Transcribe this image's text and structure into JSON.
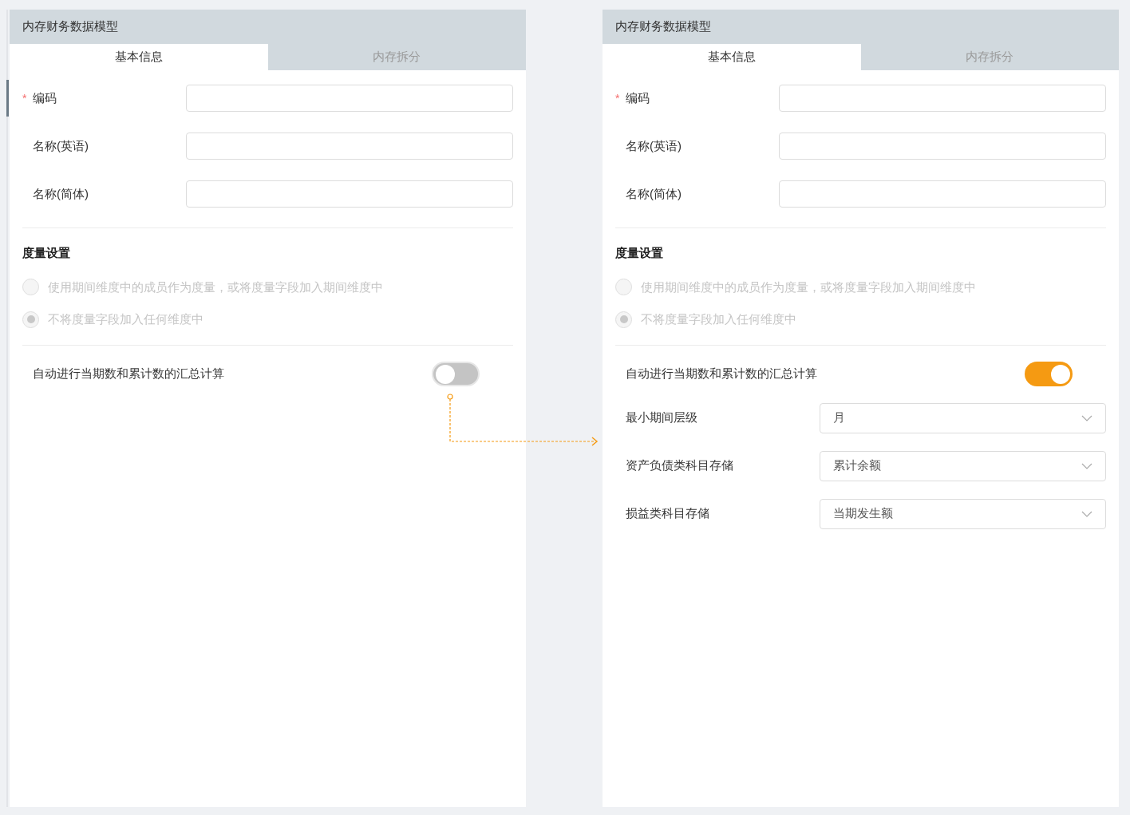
{
  "panels": [
    {
      "title": "内存财务数据模型",
      "tabs": [
        {
          "label": "基本信息",
          "selected": true
        },
        {
          "label": "内存拆分",
          "selected": false
        }
      ],
      "fields": [
        {
          "required_mark": "*",
          "label": "编码"
        },
        {
          "label": "名称(英语)"
        },
        {
          "label": "名称(简体)"
        }
      ],
      "section_title": "度量设置",
      "radios": [
        {
          "label": "使用期间维度中的成员作为度量，或将度量字段加入期间维度中",
          "selected": false,
          "disabled": true
        },
        {
          "label": "不将度量字段加入任何维度中",
          "selected": true,
          "disabled": true
        }
      ],
      "toggle": {
        "label": "自动进行当期数和累计数的汇总计算",
        "on": false
      }
    },
    {
      "title": "内存财务数据模型",
      "tabs": [
        {
          "label": "基本信息",
          "selected": true
        },
        {
          "label": "内存拆分",
          "selected": false
        }
      ],
      "fields": [
        {
          "required_mark": "*",
          "label": "编码"
        },
        {
          "label": "名称(英语)"
        },
        {
          "label": "名称(简体)"
        }
      ],
      "section_title": "度量设置",
      "radios": [
        {
          "label": "使用期间维度中的成员作为度量，或将度量字段加入期间维度中",
          "selected": false,
          "disabled": true
        },
        {
          "label": "不将度量字段加入任何维度中",
          "selected": true,
          "disabled": true
        }
      ],
      "toggle": {
        "label": "自动进行当期数和累计数的汇总计算",
        "on": true
      },
      "selects": [
        {
          "label": "最小期间层级",
          "value": "月"
        },
        {
          "label": "资产负债类科目存储",
          "value": "累计余额"
        },
        {
          "label": "损益类科目存储",
          "value": "当期发生额"
        }
      ]
    }
  ]
}
